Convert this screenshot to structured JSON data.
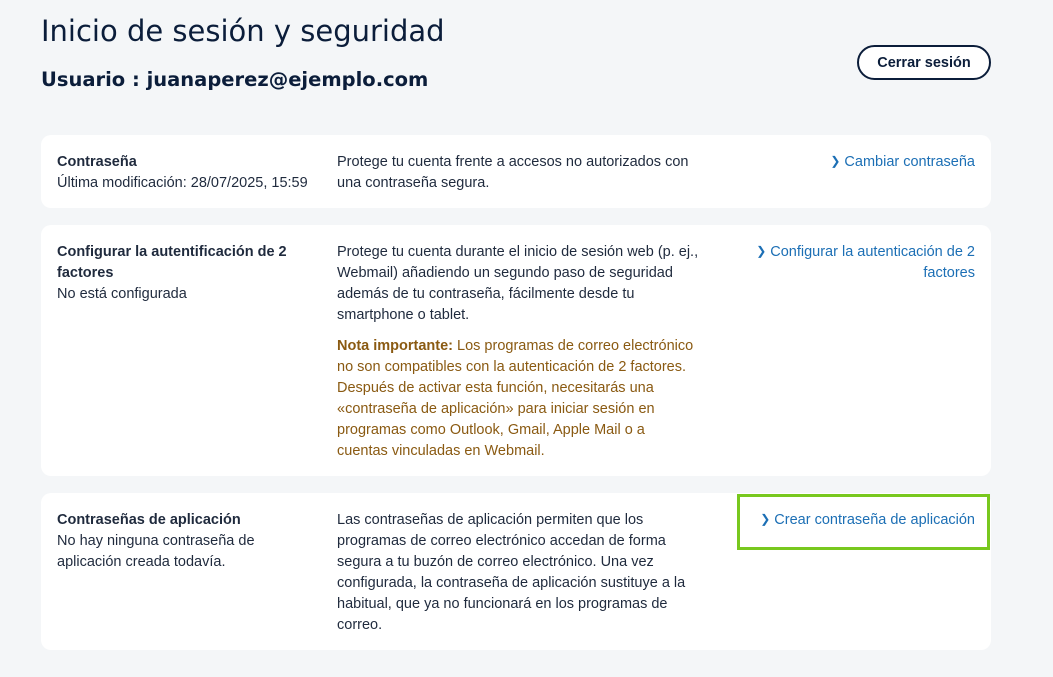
{
  "header": {
    "title": "Inicio de sesión y seguridad",
    "user_label": "Usuario : ",
    "user_email": "juanaperez@ejemplo.com",
    "logout_label": "Cerrar sesión"
  },
  "cards": [
    {
      "title": "Contraseña",
      "status": "Última modificación: 28/07/2025, 15:59",
      "description": "Protege tu cuenta frente a accesos no autorizados con una contraseña segura.",
      "action_label": "Cambiar contraseña"
    },
    {
      "title": "Configurar la autentificación de 2 factores",
      "status": "No está configurada",
      "description": "Protege tu cuenta durante el inicio de sesión web (p. ej., Webmail) añadiendo un segundo paso de seguridad además de tu contraseña, fácilmente desde tu smartphone o tablet.",
      "note_label": "Nota importante:",
      "note_text": " Los programas de correo electrónico no son compatibles con la autenticación de 2 factores. Después de activar esta función, necesitarás una «contraseña de aplicación» para iniciar sesión en programas como Outlook, Gmail, Apple Mail o a cuentas vinculadas en Webmail.",
      "action_label": "Configurar la autenticación de 2 factores"
    },
    {
      "title": "Contraseñas de aplicación",
      "status": "No hay ninguna contraseña de aplicación creada todavía.",
      "description": "Las contraseñas de aplicación permiten que los programas de correo electrónico accedan de forma segura a tu buzón de correo electrónico. Una vez configurada, la contraseña de aplicación sustituye a la habitual, que ya no funcionará en los programas de correo.",
      "action_label": "Crear contraseña de aplicación"
    }
  ],
  "icons": {
    "action_chevron": "chevron-right-icon"
  },
  "colors": {
    "background": "#f4f6f8",
    "card": "#ffffff",
    "heading": "#0b1d3a",
    "link": "#1c6fb5",
    "note": "#8a5a12",
    "highlight": "#78c81e"
  }
}
